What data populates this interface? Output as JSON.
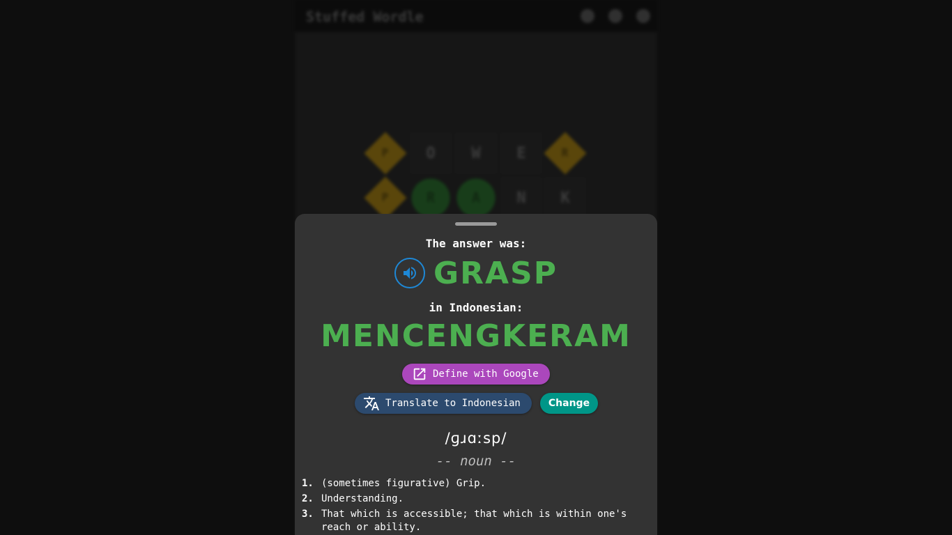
{
  "app": {
    "title": "Stuffed Wordle"
  },
  "board": {
    "rows": [
      [
        {
          "letter": "P",
          "state": "present"
        },
        {
          "letter": "O",
          "state": "absent"
        },
        {
          "letter": "W",
          "state": "absent"
        },
        {
          "letter": "E",
          "state": "absent"
        },
        {
          "letter": "R",
          "state": "present"
        }
      ],
      [
        {
          "letter": "P",
          "state": "present"
        },
        {
          "letter": "R",
          "state": "correct"
        },
        {
          "letter": "A",
          "state": "correct"
        },
        {
          "letter": "N",
          "state": "absent"
        },
        {
          "letter": "K",
          "state": "absent"
        }
      ]
    ]
  },
  "result": {
    "answer_label": "The answer was:",
    "answer": "GRASP",
    "language_label": "in Indonesian:",
    "translation": "MENCENGKERAM",
    "define_label": "Define with Google",
    "translate_label": "Translate to Indonesian",
    "change_label": "Change",
    "phonetic": "/ɡɹɑːsp/",
    "part_of_speech": "-- noun --",
    "definitions": [
      {
        "num": "1.",
        "text": "(sometimes figurative) Grip."
      },
      {
        "num": "2.",
        "text": "Understanding."
      },
      {
        "num": "3.",
        "text": "That which is accessible; that which is within one's reach or ability."
      }
    ]
  },
  "icons": {
    "speaker": "volume-up-icon",
    "define": "open-in-new-icon",
    "translate": "translate-icon"
  },
  "colors": {
    "accent_green": "#4caf50",
    "define_button": "#ab47bc",
    "translate_button": "#2c4a6e",
    "change_button": "#009688",
    "speaker_blue": "#1e88d6"
  }
}
